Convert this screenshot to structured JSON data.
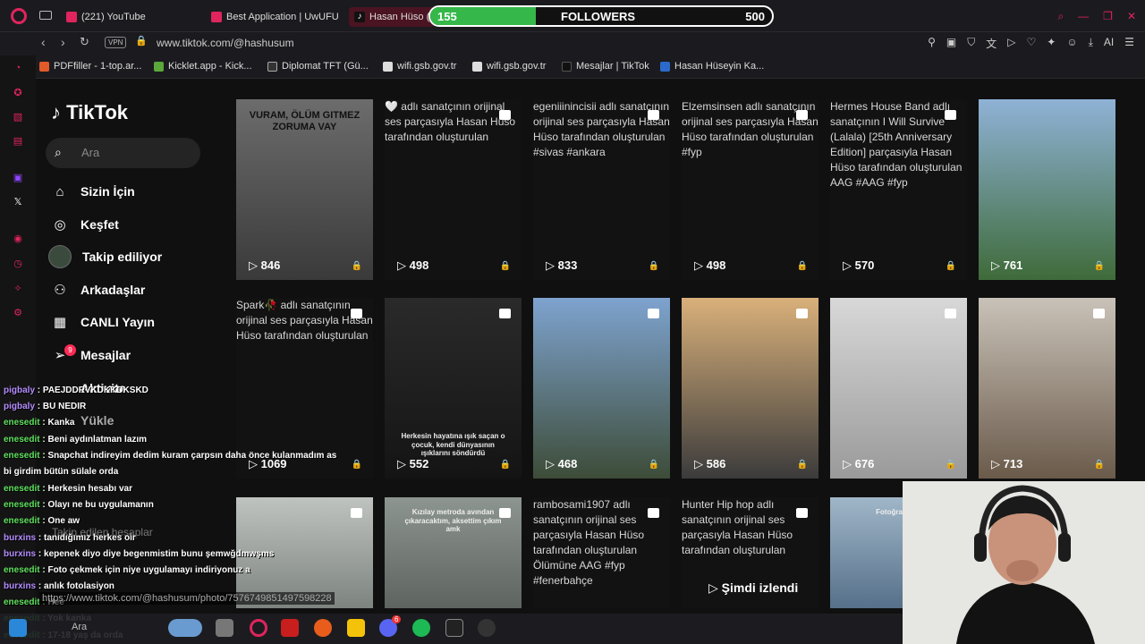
{
  "browser": {
    "tabs": [
      {
        "label": "(221) YouTube",
        "color": "#e0245e"
      },
      {
        "label": "Best Application | UwUFU",
        "color": "#e0245e"
      },
      {
        "label": "Hasan Hüso (@",
        "color": "#ffffff"
      }
    ],
    "url": "www.tiktok.com/@hashusum",
    "vpn": "VPN",
    "ai": "AI",
    "bookmarks": [
      "PDFfiller - 1-top.ar...",
      "Kicklet.app - Kick...",
      "Diplomat TFT (Gü...",
      "wifi.gsb.gov.tr",
      "wifi.gsb.gov.tr",
      "Mesajlar | TikTok",
      "Hasan Hüseyin Ka..."
    ]
  },
  "followers": {
    "current": "155",
    "label": "FOLLOWERS",
    "goal": "500",
    "progress": 0.31
  },
  "tiktok": {
    "logo": "TikTok",
    "search_placeholder": "Ara",
    "nav": [
      "Sizin İçin",
      "Keşfet",
      "Takip ediliyor",
      "Arkadaşlar",
      "CANLI Yayın",
      "Mesajlar",
      "Aktivite",
      "Yükle"
    ],
    "messages_badge": "9",
    "followed_accounts": "Takip edilen hesaplar"
  },
  "videos": [
    {
      "caption": "",
      "views": "846",
      "overlay": "VURAM, ÖLÜM GITMEZ ZORUMA VAY"
    },
    {
      "caption": "🤍 adlı sanatçının orijinal ses parçasıyla Hasan Hüso tarafından oluşturulan",
      "views": "498"
    },
    {
      "caption": "egeniiinincisii adlı sanatçının orijinal ses parçasıyla Hasan Hüso tarafından oluşturulan #sivas #ankara",
      "views": "833"
    },
    {
      "caption": "Elzemsinsen adlı sanatçının orijinal ses parçasıyla Hasan Hüso tarafından oluşturulan #fyp",
      "views": "498"
    },
    {
      "caption": "Hermes House Band adlı sanatçının I Will Survive (Lalala) [25th Anniversary Edition] parçasıyla Hasan Hüso tarafından oluşturulan AAG #AAG #fyp",
      "views": "570"
    },
    {
      "caption": "",
      "views": "761"
    },
    {
      "caption": "Spark🥀 adlı sanatçının orijinal ses parçasıyla Hasan Hüso tarafından oluşturulan",
      "views": "1069"
    },
    {
      "caption": "",
      "views": "552",
      "overlay": "Herkesin hayatına ışık saçan o çocuk, kendi dünyasının ışıklarını söndürdü"
    },
    {
      "caption": "",
      "views": "468"
    },
    {
      "caption": "",
      "views": "586"
    },
    {
      "caption": "",
      "views": "676"
    },
    {
      "caption": "",
      "views": "713"
    },
    {
      "caption": "",
      "views": ""
    },
    {
      "caption": "",
      "views": "",
      "overlay": "Kızılay metroda avından çıkaracaktım, aksettim çıkım amk"
    },
    {
      "caption": "rambosami1907 adlı sanatçının orijinal ses parçasıyla Hasan Hüso tarafından oluşturulan Ölümüne AAG #fyp #fenerbahçe",
      "views": ""
    },
    {
      "caption": "Hunter Hip hop adlı sanatçının orijinal ses parçasıyla Hasan Hüso tarafından oluşturulan",
      "views": "",
      "label": "Şimdi izlendi"
    },
    {
      "caption": "",
      "views": "",
      "overlay": "Fotoğraf kö..."
    }
  ],
  "chat": [
    {
      "user": "pigbaly",
      "msg": "PAEJDDRVKDKKDKSKD",
      "color": "#b48cff"
    },
    {
      "user": "pigbaly",
      "msg": "BU NEDIR",
      "color": "#b48cff"
    },
    {
      "user": "enesedit",
      "msg": "Kanka",
      "color": "#5ee05e"
    },
    {
      "user": "enesedit",
      "msg": "Beni aydınlatman lazım",
      "color": "#5ee05e"
    },
    {
      "user": "enesedit",
      "msg": "Snapchat indireyim dedim kuram çarpsın daha önce kulanmadım as",
      "color": "#5ee05e"
    },
    {
      "user": "",
      "msg": "bi girdim bütün sülale orda",
      "color": "#5ee05e"
    },
    {
      "user": "enesedit",
      "msg": "Herkesin hesabı var",
      "color": "#5ee05e"
    },
    {
      "user": "enesedit",
      "msg": "Olayı ne bu uygulamanın",
      "color": "#5ee05e"
    },
    {
      "user": "enesedit",
      "msg": "One aw",
      "color": "#5ee05e"
    },
    {
      "user": "burxins",
      "msg": "tanıdığımız herkes oir",
      "color": "#b48cff"
    },
    {
      "user": "burxins",
      "msg": "kepenek diyo diye begenmistim bunu şemwğdmwşms",
      "color": "#b48cff"
    },
    {
      "user": "enesedit",
      "msg": "Foto çekmek için niye uygulamayı indiriyonuz a",
      "color": "#5ee05e"
    },
    {
      "user": "burxins",
      "msg": "anlık fotolasiyon",
      "color": "#b48cff"
    },
    {
      "user": "enesedit",
      "msg": "Hee",
      "color": "#5ee05e"
    },
    {
      "user": "enesedit",
      "msg": "Yok kanka",
      "color": "#5ee05e"
    },
    {
      "user": "enesedit",
      "msg": "17-18 yaş da orda",
      "color": "#5ee05e"
    }
  ],
  "status_url": "https://www.tiktok.com/@hashusum/photo/7576749851497598228",
  "taskbar": {
    "search": "Ara",
    "discord_badge": "6"
  }
}
